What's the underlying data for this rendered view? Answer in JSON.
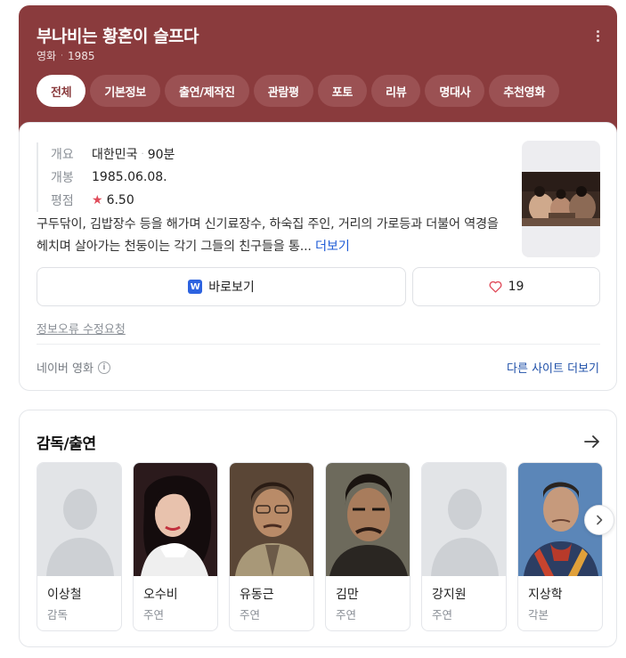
{
  "header": {
    "title": "부나비는 황혼이 슬프다",
    "category": "영화",
    "year": "1985",
    "accent_color": "#8a3b3d"
  },
  "tabs": [
    {
      "label": "전체",
      "active": true
    },
    {
      "label": "기본정보",
      "active": false
    },
    {
      "label": "출연/제작진",
      "active": false
    },
    {
      "label": "관람평",
      "active": false
    },
    {
      "label": "포토",
      "active": false
    },
    {
      "label": "리뷰",
      "active": false
    },
    {
      "label": "명대사",
      "active": false
    },
    {
      "label": "추천영화",
      "active": false
    }
  ],
  "info": {
    "overview_label": "개요",
    "country": "대한민국",
    "runtime": "90분",
    "release_label": "개봉",
    "release_date": "1985.06.08.",
    "rating_label": "평점",
    "rating": "6.50"
  },
  "synopsis": {
    "text": "구두닦이, 김밥장수 등을 해가며 신기료장수, 하숙집 주인, 거리의 가로등과 더불어 역경을 헤치며 살아가는 천둥이는 각기 그들의 친구들을 통...",
    "more_label": "더보기"
  },
  "actions": {
    "watch_label": "바로보기",
    "like_count": "19"
  },
  "report_label": "정보오류 수정요청",
  "source_label": "네이버 영화",
  "other_sites_label": "다른 사이트 더보기",
  "cast": {
    "title": "감독/출연",
    "people": [
      {
        "name": "이상철",
        "role": "감독"
      },
      {
        "name": "오수비",
        "role": "주연"
      },
      {
        "name": "유동근",
        "role": "주연"
      },
      {
        "name": "김만",
        "role": "주연"
      },
      {
        "name": "강지원",
        "role": "주연"
      },
      {
        "name": "지상학",
        "role": "각본"
      }
    ]
  }
}
